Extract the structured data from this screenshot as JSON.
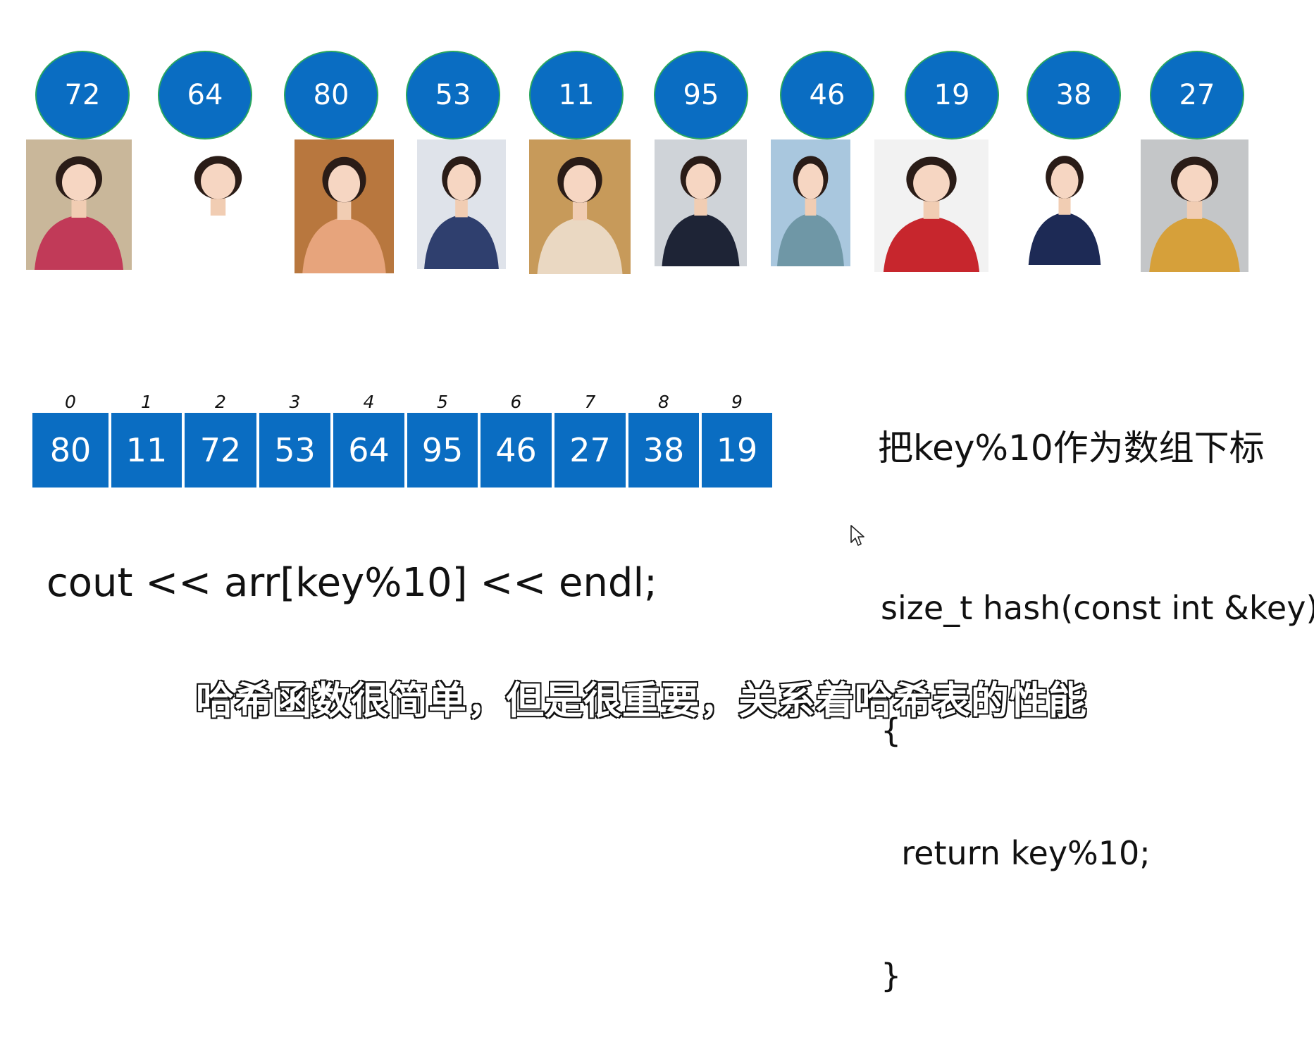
{
  "top_keys": [
    "72",
    "64",
    "80",
    "53",
    "11",
    "95",
    "46",
    "19",
    "38",
    "27"
  ],
  "photos": [
    {
      "icon": "person-photo",
      "bg": "#c9b79a",
      "outfit": "#c13a58"
    },
    {
      "icon": "person-photo",
      "bg": "#ffffff",
      "outfit": "#ffffff"
    },
    {
      "icon": "person-photo",
      "bg": "#b8773e",
      "outfit": "#e7a47c"
    },
    {
      "icon": "person-photo",
      "bg": "#dfe3ea",
      "outfit": "#2f3f6e"
    },
    {
      "icon": "person-photo",
      "bg": "#c79a5a",
      "outfit": "#ead8c2"
    },
    {
      "icon": "person-photo",
      "bg": "#cfd3d8",
      "outfit": "#1e2436"
    },
    {
      "icon": "person-photo",
      "bg": "#a9c7de",
      "outfit": "#6f97a6"
    },
    {
      "icon": "person-photo",
      "bg": "#f2f2f2",
      "outfit": "#c7262d"
    },
    {
      "icon": "person-photo",
      "bg": "#ffffff",
      "outfit": "#1d2a55"
    },
    {
      "icon": "person-photo",
      "bg": "#c4c6c8",
      "outfit": "#d6a03a"
    }
  ],
  "array": {
    "indices": [
      "0",
      "1",
      "2",
      "3",
      "4",
      "5",
      "6",
      "7",
      "8",
      "9"
    ],
    "values": [
      "80",
      "11",
      "72",
      "53",
      "64",
      "95",
      "46",
      "27",
      "38",
      "19"
    ]
  },
  "cout_line": "cout << arr[key%10] << endl;",
  "description": "把key%10作为数组下标",
  "code_lines": [
    "size_t hash(const int &key)",
    "{",
    "  return key%10;",
    "}"
  ],
  "subtitle": "哈希函数很简单，但是很重要，关系着哈希表的性能",
  "colors": {
    "circle_fill": "#0a6dc2",
    "circle_border": "#2aa760",
    "cell_fill": "#0a6dc2"
  }
}
